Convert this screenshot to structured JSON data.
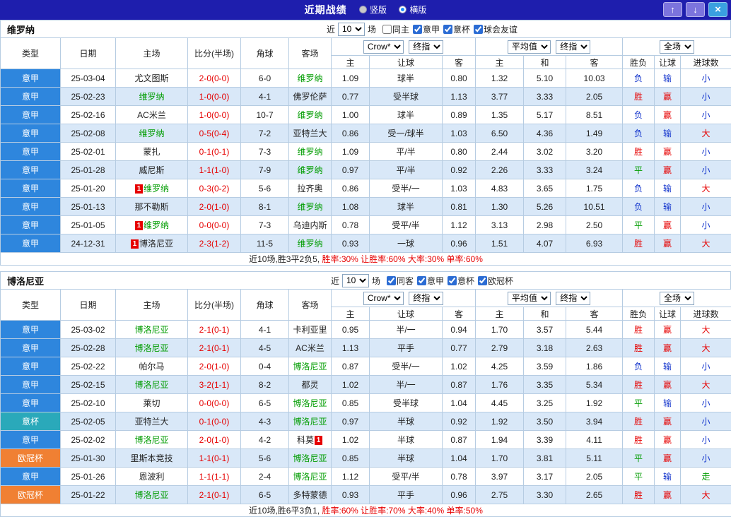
{
  "colors": {
    "titlebar": "#1e1ead",
    "grid": "#b6cce2",
    "row_alt": "#d9e8f8",
    "serie_a": "#2e86dd",
    "coppa_italia": "#2aa9ba",
    "champions_league": "#f08033",
    "focus_team": "#009c00",
    "score_red": "#e60000",
    "res_red": "#e60000",
    "res_green": "#009c00",
    "res_blue": "#1133cc",
    "btn_purple": "#7c74dd",
    "btn_blue": "#3aa0e0"
  },
  "titlebar": {
    "title": "近期战绩",
    "radio_vertical": "竖版",
    "radio_horizontal": "横版",
    "btn_up": "↑",
    "btn_down": "↓",
    "btn_close": "×"
  },
  "columns": [
    "类型",
    "日期",
    "主场",
    "比分(半场)",
    "角球",
    "客场",
    "主",
    "让球",
    "客",
    "主",
    "和",
    "客",
    "胜负",
    "让球",
    "进球数"
  ],
  "filters": {
    "near_label": "近",
    "count": "10",
    "matches_label": "场",
    "odds_company": "Crow*",
    "handicap_time": "终指",
    "euro_mode": "平均值",
    "euro_time": "终指",
    "scope": "全场"
  },
  "type_color_map": {
    "意甲": "serie",
    "意杯": "coppa",
    "欧冠杯": "ucl"
  },
  "result_color_map": {
    "胜": "red",
    "赢": "red",
    "大": "red",
    "平": "green",
    "走": "green",
    "负": "blue",
    "输": "blue",
    "小": "blue"
  },
  "sections": [
    {
      "team": "维罗纳",
      "checkboxes": [
        {
          "label": "同主",
          "checked": false
        },
        {
          "label": "意甲",
          "checked": true
        },
        {
          "label": "意杯",
          "checked": true
        },
        {
          "label": "球会友谊",
          "checked": true
        }
      ],
      "rows": [
        {
          "type": "意甲",
          "date": "25-03-04",
          "home": {
            "name": "尤文图斯"
          },
          "score": "2-0(0-0)",
          "corner": "6-0",
          "away": {
            "name": "维罗纳",
            "focus": true
          },
          "handicap": [
            "1.09",
            "球半",
            "0.80"
          ],
          "euro": [
            "1.32",
            "5.10",
            "10.03"
          ],
          "results": [
            "负",
            "输",
            "小"
          ]
        },
        {
          "type": "意甲",
          "date": "25-02-23",
          "home": {
            "name": "维罗纳",
            "focus": true
          },
          "score": "1-0(0-0)",
          "corner": "4-1",
          "away": {
            "name": "佛罗伦萨"
          },
          "handicap": [
            "0.77",
            "受半球",
            "1.13"
          ],
          "euro": [
            "3.77",
            "3.33",
            "2.05"
          ],
          "results": [
            "胜",
            "赢",
            "小"
          ]
        },
        {
          "type": "意甲",
          "date": "25-02-16",
          "home": {
            "name": "AC米兰"
          },
          "score": "1-0(0-0)",
          "corner": "10-7",
          "away": {
            "name": "维罗纳",
            "focus": true
          },
          "handicap": [
            "1.00",
            "球半",
            "0.89"
          ],
          "euro": [
            "1.35",
            "5.17",
            "8.51"
          ],
          "results": [
            "负",
            "赢",
            "小"
          ]
        },
        {
          "type": "意甲",
          "date": "25-02-08",
          "home": {
            "name": "维罗纳",
            "focus": true
          },
          "score": "0-5(0-4)",
          "corner": "7-2",
          "away": {
            "name": "亚特兰大"
          },
          "handicap": [
            "0.86",
            "受一/球半",
            "1.03"
          ],
          "euro": [
            "6.50",
            "4.36",
            "1.49"
          ],
          "results": [
            "负",
            "输",
            "大"
          ]
        },
        {
          "type": "意甲",
          "date": "25-02-01",
          "home": {
            "name": "蒙扎"
          },
          "score": "0-1(0-1)",
          "corner": "7-3",
          "away": {
            "name": "维罗纳",
            "focus": true
          },
          "handicap": [
            "1.09",
            "平/半",
            "0.80"
          ],
          "euro": [
            "2.44",
            "3.02",
            "3.20"
          ],
          "results": [
            "胜",
            "赢",
            "小"
          ]
        },
        {
          "type": "意甲",
          "date": "25-01-28",
          "home": {
            "name": "威尼斯"
          },
          "score": "1-1(1-0)",
          "corner": "7-9",
          "away": {
            "name": "维罗纳",
            "focus": true
          },
          "handicap": [
            "0.97",
            "平/半",
            "0.92"
          ],
          "euro": [
            "2.26",
            "3.33",
            "3.24"
          ],
          "results": [
            "平",
            "赢",
            "小"
          ]
        },
        {
          "type": "意甲",
          "date": "25-01-20",
          "home": {
            "name": "维罗纳",
            "focus": true,
            "badge": "1"
          },
          "score": "0-3(0-2)",
          "corner": "5-6",
          "away": {
            "name": "拉齐奥"
          },
          "handicap": [
            "0.86",
            "受半/一",
            "1.03"
          ],
          "euro": [
            "4.83",
            "3.65",
            "1.75"
          ],
          "results": [
            "负",
            "输",
            "大"
          ]
        },
        {
          "type": "意甲",
          "date": "25-01-13",
          "home": {
            "name": "那不勒斯"
          },
          "score": "2-0(1-0)",
          "corner": "8-1",
          "away": {
            "name": "维罗纳",
            "focus": true
          },
          "handicap": [
            "1.08",
            "球半",
            "0.81"
          ],
          "euro": [
            "1.30",
            "5.26",
            "10.51"
          ],
          "results": [
            "负",
            "输",
            "小"
          ]
        },
        {
          "type": "意甲",
          "date": "25-01-05",
          "home": {
            "name": "维罗纳",
            "focus": true,
            "badge": "1"
          },
          "score": "0-0(0-0)",
          "corner": "7-3",
          "away": {
            "name": "乌迪内斯"
          },
          "handicap": [
            "0.78",
            "受平/半",
            "1.12"
          ],
          "euro": [
            "3.13",
            "2.98",
            "2.50"
          ],
          "results": [
            "平",
            "赢",
            "小"
          ]
        },
        {
          "type": "意甲",
          "date": "24-12-31",
          "home": {
            "name": "博洛尼亚",
            "badge": "1"
          },
          "score": "2-3(1-2)",
          "corner": "11-5",
          "away": {
            "name": "维罗纳",
            "focus": true
          },
          "handicap": [
            "0.93",
            "一球",
            "0.96"
          ],
          "euro": [
            "1.51",
            "4.07",
            "6.93"
          ],
          "results": [
            "胜",
            "赢",
            "大"
          ]
        }
      ],
      "summary_record": "近10场,胜3平2负5,",
      "summary_rates": " 胜率:30% 让胜率:60% 大率:30% 单率:60%"
    },
    {
      "team": "博洛尼亚",
      "checkboxes": [
        {
          "label": "同客",
          "checked": true
        },
        {
          "label": "意甲",
          "checked": true
        },
        {
          "label": "意杯",
          "checked": true
        },
        {
          "label": "欧冠杯",
          "checked": true
        }
      ],
      "rows": [
        {
          "type": "意甲",
          "date": "25-03-02",
          "home": {
            "name": "博洛尼亚",
            "focus": true
          },
          "score": "2-1(0-1)",
          "corner": "4-1",
          "away": {
            "name": "卡利亚里"
          },
          "handicap": [
            "0.95",
            "半/一",
            "0.94"
          ],
          "euro": [
            "1.70",
            "3.57",
            "5.44"
          ],
          "results": [
            "胜",
            "赢",
            "大"
          ]
        },
        {
          "type": "意甲",
          "date": "25-02-28",
          "home": {
            "name": "博洛尼亚",
            "focus": true
          },
          "score": "2-1(0-1)",
          "corner": "4-5",
          "away": {
            "name": "AC米兰"
          },
          "handicap": [
            "1.13",
            "平手",
            "0.77"
          ],
          "euro": [
            "2.79",
            "3.18",
            "2.63"
          ],
          "results": [
            "胜",
            "赢",
            "大"
          ]
        },
        {
          "type": "意甲",
          "date": "25-02-22",
          "home": {
            "name": "帕尔马"
          },
          "score": "2-0(1-0)",
          "corner": "0-4",
          "away": {
            "name": "博洛尼亚",
            "focus": true
          },
          "handicap": [
            "0.87",
            "受半/一",
            "1.02"
          ],
          "euro": [
            "4.25",
            "3.59",
            "1.86"
          ],
          "results": [
            "负",
            "输",
            "小"
          ]
        },
        {
          "type": "意甲",
          "date": "25-02-15",
          "home": {
            "name": "博洛尼亚",
            "focus": true
          },
          "score": "3-2(1-1)",
          "corner": "8-2",
          "away": {
            "name": "都灵"
          },
          "handicap": [
            "1.02",
            "半/一",
            "0.87"
          ],
          "euro": [
            "1.76",
            "3.35",
            "5.34"
          ],
          "results": [
            "胜",
            "赢",
            "大"
          ]
        },
        {
          "type": "意甲",
          "date": "25-02-10",
          "home": {
            "name": "莱切"
          },
          "score": "0-0(0-0)",
          "corner": "6-5",
          "away": {
            "name": "博洛尼亚",
            "focus": true
          },
          "handicap": [
            "0.85",
            "受半球",
            "1.04"
          ],
          "euro": [
            "4.45",
            "3.25",
            "1.92"
          ],
          "results": [
            "平",
            "输",
            "小"
          ]
        },
        {
          "type": "意杯",
          "date": "25-02-05",
          "home": {
            "name": "亚特兰大"
          },
          "score": "0-1(0-0)",
          "corner": "4-3",
          "away": {
            "name": "博洛尼亚",
            "focus": true
          },
          "handicap": [
            "0.97",
            "半球",
            "0.92"
          ],
          "euro": [
            "1.92",
            "3.50",
            "3.94"
          ],
          "results": [
            "胜",
            "赢",
            "小"
          ]
        },
        {
          "type": "意甲",
          "date": "25-02-02",
          "home": {
            "name": "博洛尼亚",
            "focus": true
          },
          "score": "2-0(1-0)",
          "corner": "4-2",
          "away": {
            "name": "科莫",
            "badge": "1",
            "badge_pos": "after"
          },
          "handicap": [
            "1.02",
            "半球",
            "0.87"
          ],
          "euro": [
            "1.94",
            "3.39",
            "4.11"
          ],
          "results": [
            "胜",
            "赢",
            "小"
          ]
        },
        {
          "type": "欧冠杯",
          "date": "25-01-30",
          "home": {
            "name": "里斯本竞技"
          },
          "score": "1-1(0-1)",
          "corner": "5-6",
          "away": {
            "name": "博洛尼亚",
            "focus": true
          },
          "handicap": [
            "0.85",
            "半球",
            "1.04"
          ],
          "euro": [
            "1.70",
            "3.81",
            "5.11"
          ],
          "results": [
            "平",
            "赢",
            "小"
          ]
        },
        {
          "type": "意甲",
          "date": "25-01-26",
          "home": {
            "name": "恩波利"
          },
          "score": "1-1(1-1)",
          "corner": "2-4",
          "away": {
            "name": "博洛尼亚",
            "focus": true
          },
          "handicap": [
            "1.12",
            "受平/半",
            "0.78"
          ],
          "euro": [
            "3.97",
            "3.17",
            "2.05"
          ],
          "results": [
            "平",
            "输",
            "走"
          ]
        },
        {
          "type": "欧冠杯",
          "date": "25-01-22",
          "home": {
            "name": "博洛尼亚",
            "focus": true
          },
          "score": "2-1(0-1)",
          "corner": "6-5",
          "away": {
            "name": "多特蒙德"
          },
          "handicap": [
            "0.93",
            "平手",
            "0.96"
          ],
          "euro": [
            "2.75",
            "3.30",
            "2.65"
          ],
          "results": [
            "胜",
            "赢",
            "大"
          ]
        }
      ],
      "summary_record": "近10场,胜6平3负1,",
      "summary_rates": " 胜率:60% 让胜率:70% 大率:40% 单率:50%"
    }
  ]
}
